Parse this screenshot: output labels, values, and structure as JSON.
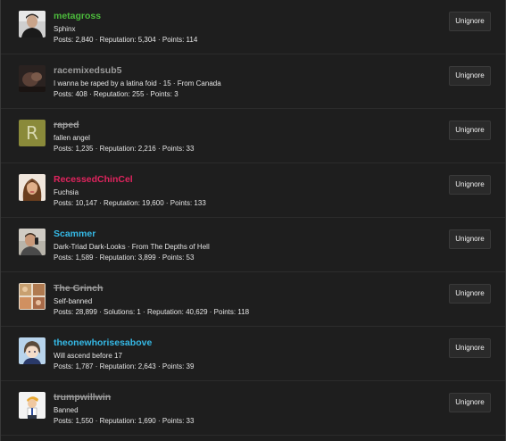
{
  "colors": {
    "background": "#1e1e1e",
    "divider": "#2c2c2c",
    "button_bg": "#2a2a2a",
    "text": "#e4e4e4"
  },
  "users": [
    {
      "username": "metagross",
      "username_color": "#4cba3c",
      "strikethrough": false,
      "user_title": "Sphinx",
      "stats": "Posts: 2,840 · Reputation: 5,304 · Points: 114",
      "button_label": "Unignore",
      "avatar": "photo-avatar-man"
    },
    {
      "username": "racemixedsub5",
      "username_color": "#9a9a9a",
      "strikethrough": false,
      "user_title": "I wanna be raped by a latina foid · 15 · From Canada",
      "stats": "Posts: 408 · Reputation: 255 · Points: 3",
      "button_label": "Unignore",
      "avatar": "photo-avatar-dark"
    },
    {
      "username": "raped",
      "username_color": "#9a9a9a",
      "strikethrough": true,
      "user_title": "fallen angel",
      "stats": "Posts: 1,235 · Reputation: 2,216 · Points: 33",
      "button_label": "Unignore",
      "avatar": "letter-avatar",
      "avatar_letter": "R",
      "avatar_bg": "#8a8a3a",
      "avatar_fg": "#d8d8b0"
    },
    {
      "username": "RecessedChinCel",
      "username_color": "#e0245e",
      "strikethrough": false,
      "user_title": "Fuchsia",
      "stats": "Posts: 10,147 · Reputation: 19,600 · Points: 133",
      "button_label": "Unignore",
      "avatar": "photo-avatar-woman"
    },
    {
      "username": "Scammer",
      "username_color": "#35b9e6",
      "strikethrough": false,
      "user_title": "Dark-Triad Dark-Looks · From The Depths of Hell",
      "stats": "Posts: 1,589 · Reputation: 3,899 · Points: 53",
      "button_label": "Unignore",
      "avatar": "photo-avatar-man-phone"
    },
    {
      "username": "The Grinch",
      "username_color": "#9a9a9a",
      "strikethrough": true,
      "user_title": "Self-banned",
      "stats": "Posts: 28,899 · Solutions: 1 · Reputation: 40,629 · Points: 118",
      "button_label": "Unignore",
      "avatar": "photo-avatar-collage"
    },
    {
      "username": "theonewhorisesabove",
      "username_color": "#35b9e6",
      "strikethrough": false,
      "user_title": "Will ascend before 17",
      "stats": "Posts: 1,787 · Reputation: 2,643 · Points: 39",
      "button_label": "Unignore",
      "avatar": "anime-avatar"
    },
    {
      "username": "trumpwillwin",
      "username_color": "#9a9a9a",
      "strikethrough": true,
      "user_title": "Banned",
      "stats": "Posts: 1,550 · Reputation: 1,690 · Points: 33",
      "button_label": "Unignore",
      "avatar": "cartoon-avatar"
    }
  ]
}
